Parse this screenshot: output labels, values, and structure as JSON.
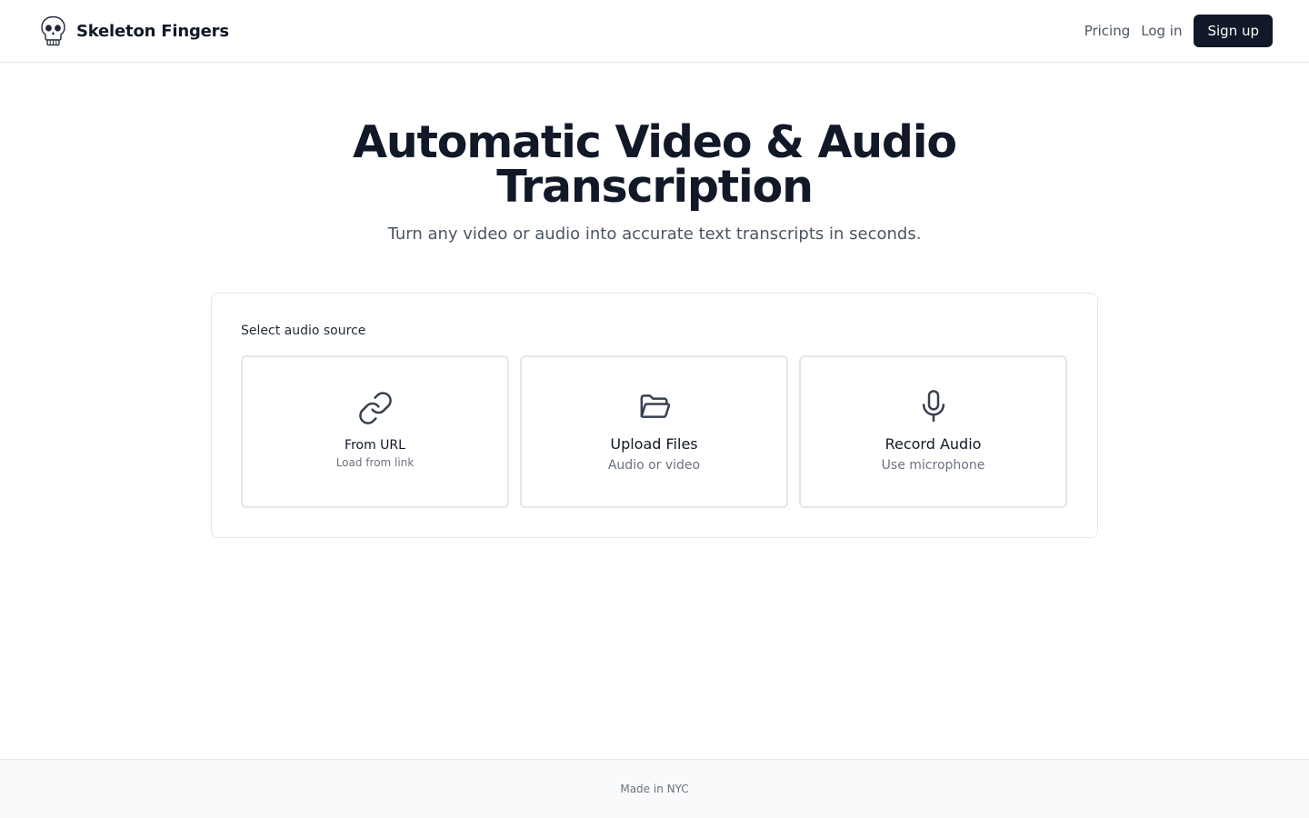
{
  "header": {
    "brand_name": "Skeleton Fingers",
    "logo_icon": "skull-icon",
    "nav": {
      "pricing_label": "Pricing",
      "login_label": "Log in",
      "signup_label": "Sign up"
    }
  },
  "hero": {
    "title_line1": "Automatic Video & Audio",
    "title_line2": "Transcription",
    "subtitle": "Turn any video or audio into accurate text transcripts in seconds."
  },
  "source_selector": {
    "label": "Select audio source",
    "options": [
      {
        "title": "From URL",
        "subtitle": "Load from link",
        "icon": "link-icon"
      },
      {
        "title": "Upload Files",
        "subtitle": "Audio or video",
        "icon": "folder-icon"
      },
      {
        "title": "Record Audio",
        "subtitle": "Use microphone",
        "icon": "microphone-icon"
      }
    ]
  },
  "footer": {
    "text": "Made in NYC"
  },
  "colors": {
    "primary_dark": "#111827",
    "muted_text": "#6b7280",
    "border": "#e5e7eb",
    "footer_bg": "#f9fafb"
  }
}
